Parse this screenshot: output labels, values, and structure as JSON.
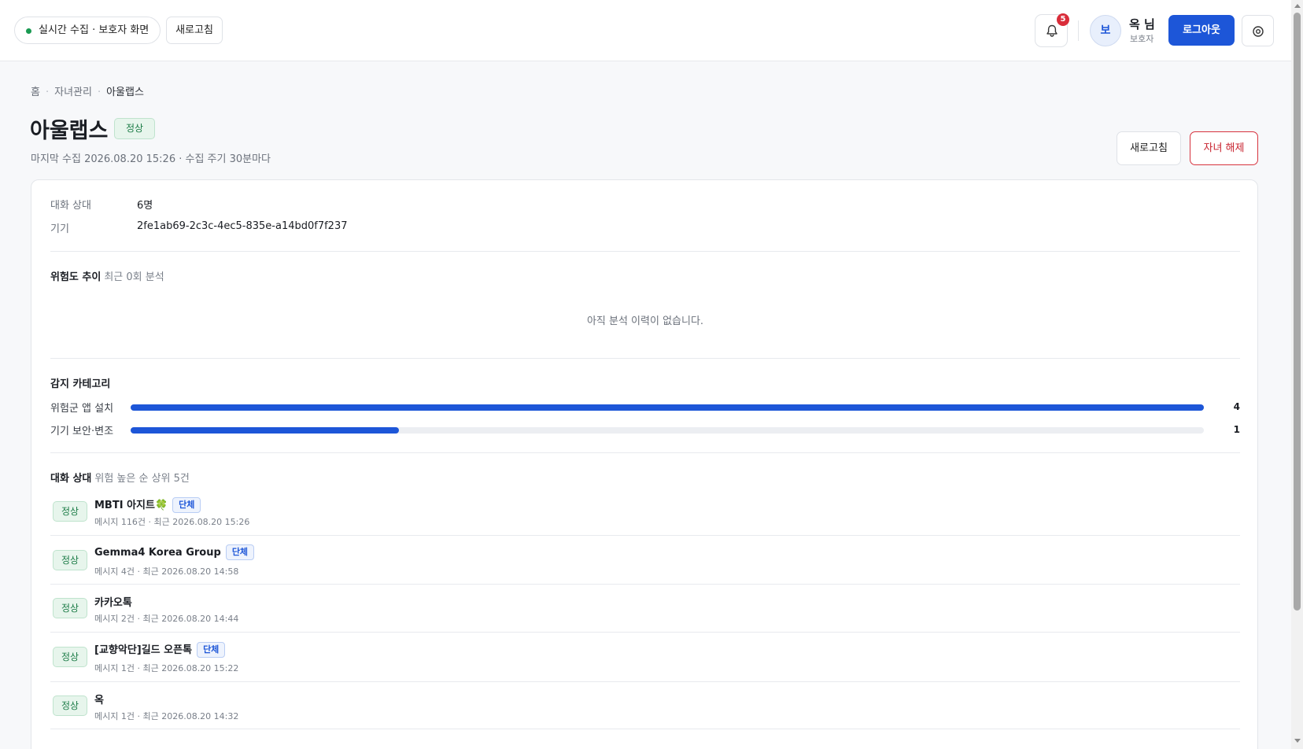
{
  "header": {
    "live_label": "실시간 수집 · 보호자 화면",
    "refresh_label": "새로고침",
    "notification_count": "5",
    "avatar_initial": "보",
    "user_name": "옥 님",
    "user_role": "보호자",
    "logout_label": "로그아웃",
    "icons": {
      "bell": "bell-icon",
      "settings": "settings-icon"
    }
  },
  "breadcrumb": [
    "홈",
    "자녀관리",
    "아울랩스"
  ],
  "page": {
    "title": "아울랩스",
    "status_badge": "정상",
    "subtitle": "마지막 수집 2026.08.20 15:26 · 수집 주기 30분마다",
    "refresh_button": "새로고침",
    "unlink_button": "자녀 해제"
  },
  "summary": {
    "contacts_label": "대화 상대",
    "contacts_value": "6명",
    "device_label": "기기",
    "device_value": "2fe1ab69-2c3c-4ec5-835e-a14bd0f7f237"
  },
  "risk_trend": {
    "title": "위험도 추이",
    "note": "최근 0회 분석",
    "empty_message": "아직 분석 이력이 없습니다."
  },
  "categories": {
    "title": "감지 카테고리",
    "items": [
      {
        "label": "위험군 앱 설치",
        "count": "4",
        "fraction": 1.0
      },
      {
        "label": "기기 보안·변조",
        "count": "1",
        "fraction": 0.25
      }
    ]
  },
  "conversations": {
    "title": "대화 상대",
    "note": "위험 높은 순 상위 5건",
    "items": [
      {
        "status": "정상",
        "name": "MBTI 아지트🍀",
        "group_tag": "단체",
        "meta": "메시지 116건 · 최근 2026.08.20 15:26"
      },
      {
        "status": "정상",
        "name": "Gemma4 Korea Group",
        "group_tag": "단체",
        "meta": "메시지 4건 · 최근 2026.08.20 14:58"
      },
      {
        "status": "정상",
        "name": "카카오톡",
        "group_tag": "",
        "meta": "메시지 2건 · 최근 2026.08.20 14:44"
      },
      {
        "status": "정상",
        "name": "[교향악단]길드 오픈톡",
        "group_tag": "단체",
        "meta": "메시지 1건 · 최근 2026.08.20 15:22"
      },
      {
        "status": "정상",
        "name": "옥",
        "group_tag": "",
        "meta": "메시지 1건 · 최근 2026.08.20 14:32"
      }
    ]
  },
  "colors": {
    "accent": "#1d56d8",
    "danger": "#c8232f",
    "ok": "#1c7c47"
  }
}
